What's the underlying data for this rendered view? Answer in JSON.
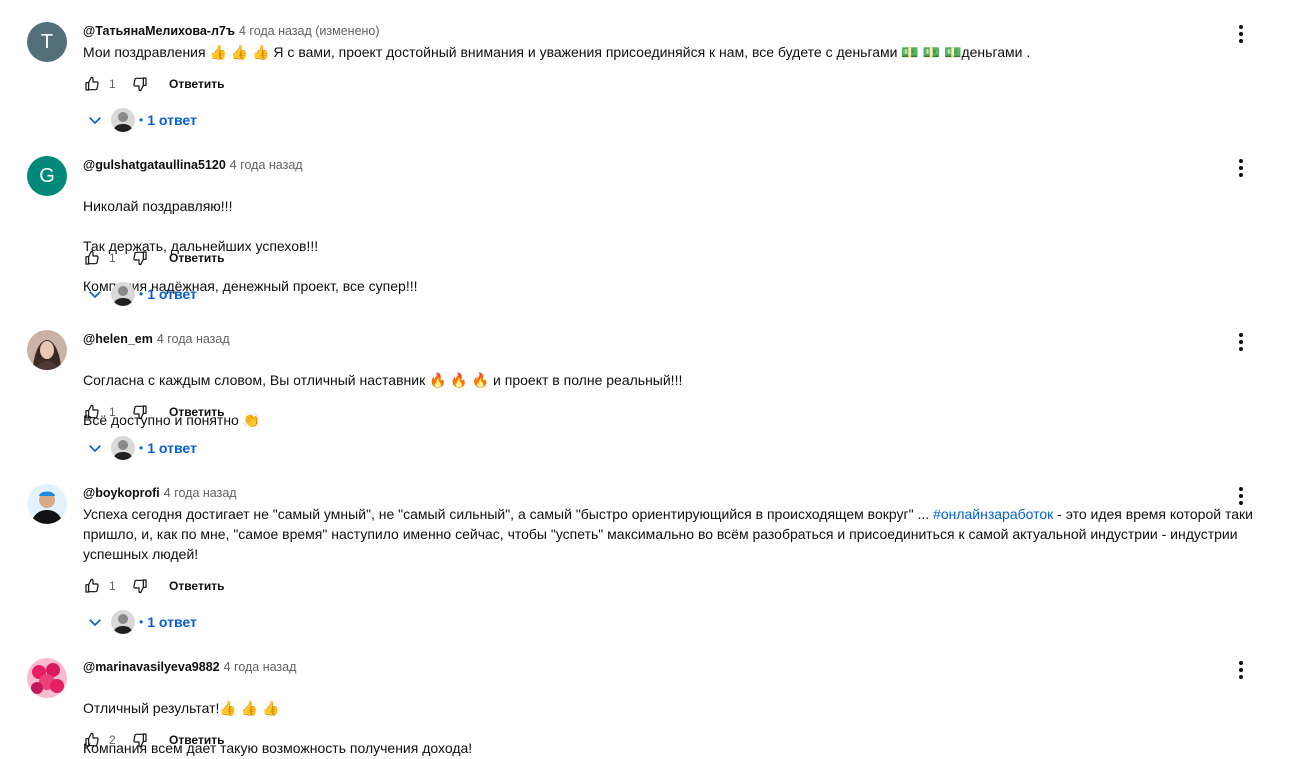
{
  "comments": [
    {
      "author": "@ТатьянаМелихова-л7ъ",
      "time": "4 года назад (изменено)",
      "avatar_letter": "T",
      "avatar_color": "#546e7a",
      "lines": [
        "Мои поздравления 👍 👍 👍  Я с вами, проект достойный внимания и уважения присоединяйся к нам, все будете с деньгами 💵 💵 💵деньгами ."
      ],
      "likes": "1",
      "reply_label": "Ответить",
      "replies": "1 ответ"
    },
    {
      "author": "@gulshatgataullina5120",
      "time": "4 года назад",
      "avatar_letter": "G",
      "avatar_color": "#00897b",
      "lines": [
        "Николай поздравляю!!!",
        "Так держать, дальнейших успехов!!!",
        "Компания надёжная, денежный проект, все супер!!!"
      ],
      "likes": "1",
      "reply_label": "Ответить",
      "replies": "1 ответ"
    },
    {
      "author": "@helen_em",
      "time": "4 года назад",
      "avatar_letter": "",
      "avatar_color": "#8d6e63",
      "lines": [
        "Согласна с каждым словом, Вы отличный наставник 🔥 🔥 🔥 и проект в полне реальный!!!",
        "Всё доступно и понятно 👏"
      ],
      "likes": "1",
      "reply_label": "Ответить",
      "replies": "1 ответ"
    },
    {
      "author": "@boykoprofi",
      "time": "4 года назад",
      "avatar_letter": "",
      "avatar_color": "#1e88e5",
      "text_before_tag": "Успеха сегодня достигает не \"самый умный\", не \"самый сильный\", а самый \"быстро ориентирующийся в происходящем вокруг\" ... ",
      "hashtag": "#онлайнзаработок",
      "text_after_tag": " - это идея время которой таки пришло, и, как по мне, \"самое время\" наступило именно сейчас, чтобы \"успеть\" максимально во всём разобраться и присоединиться к самой актуальной индустрии - индустрии успешных людей!",
      "likes": "1",
      "reply_label": "Ответить",
      "replies": "1 ответ"
    },
    {
      "author": "@marinavasilyeva9882",
      "time": "4 года назад",
      "avatar_letter": "",
      "avatar_color": "#e91e63",
      "lines": [
        "Отличный результат!👍 👍 👍",
        "Компания всем дает такую возможность получения дохода!"
      ],
      "likes": "2",
      "reply_label": "Ответить"
    }
  ]
}
